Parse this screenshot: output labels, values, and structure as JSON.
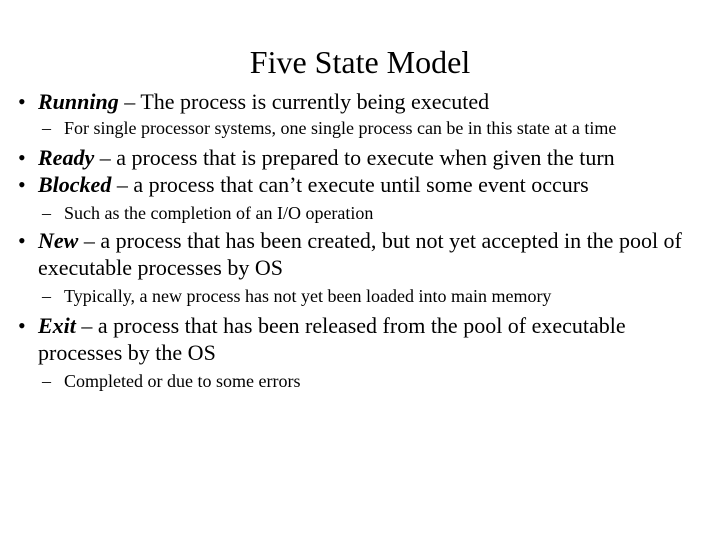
{
  "slide": {
    "title": "Five State Model",
    "background_color": "#ffffff",
    "text_color": "#000000",
    "bullets": [
      {
        "level": 1,
        "marker": "•",
        "term": "Running",
        "separator": " – ",
        "text": "The process is currently being executed"
      },
      {
        "level": 2,
        "marker": "–",
        "term": "",
        "separator": "",
        "text": "For single processor systems, one single process can be in this state at a time"
      },
      {
        "level": 1,
        "marker": "•",
        "term": "Ready",
        "separator": " – ",
        "text": "a process that is prepared to execute when given the turn"
      },
      {
        "level": 1,
        "marker": "•",
        "term": "Blocked",
        "separator": " – ",
        "text": "a process that can’t execute until some event occurs"
      },
      {
        "level": 2,
        "marker": "–",
        "term": "",
        "separator": "",
        "text": "Such as the completion of an I/O operation"
      },
      {
        "level": 1,
        "marker": "•",
        "term": "New",
        "separator": " – ",
        "text": "a process that has been created, but not yet accepted in the pool of executable processes by OS"
      },
      {
        "level": 2,
        "marker": "–",
        "term": "",
        "separator": "",
        "text": "Typically, a new process has not yet been loaded into main memory"
      },
      {
        "level": 1,
        "marker": "•",
        "term": "Exit",
        "separator": " – ",
        "text": "a process that has been released from the pool of executable processes by the OS"
      },
      {
        "level": 2,
        "marker": "–",
        "term": "",
        "separator": "",
        "text": "Completed or due to some errors"
      }
    ]
  }
}
